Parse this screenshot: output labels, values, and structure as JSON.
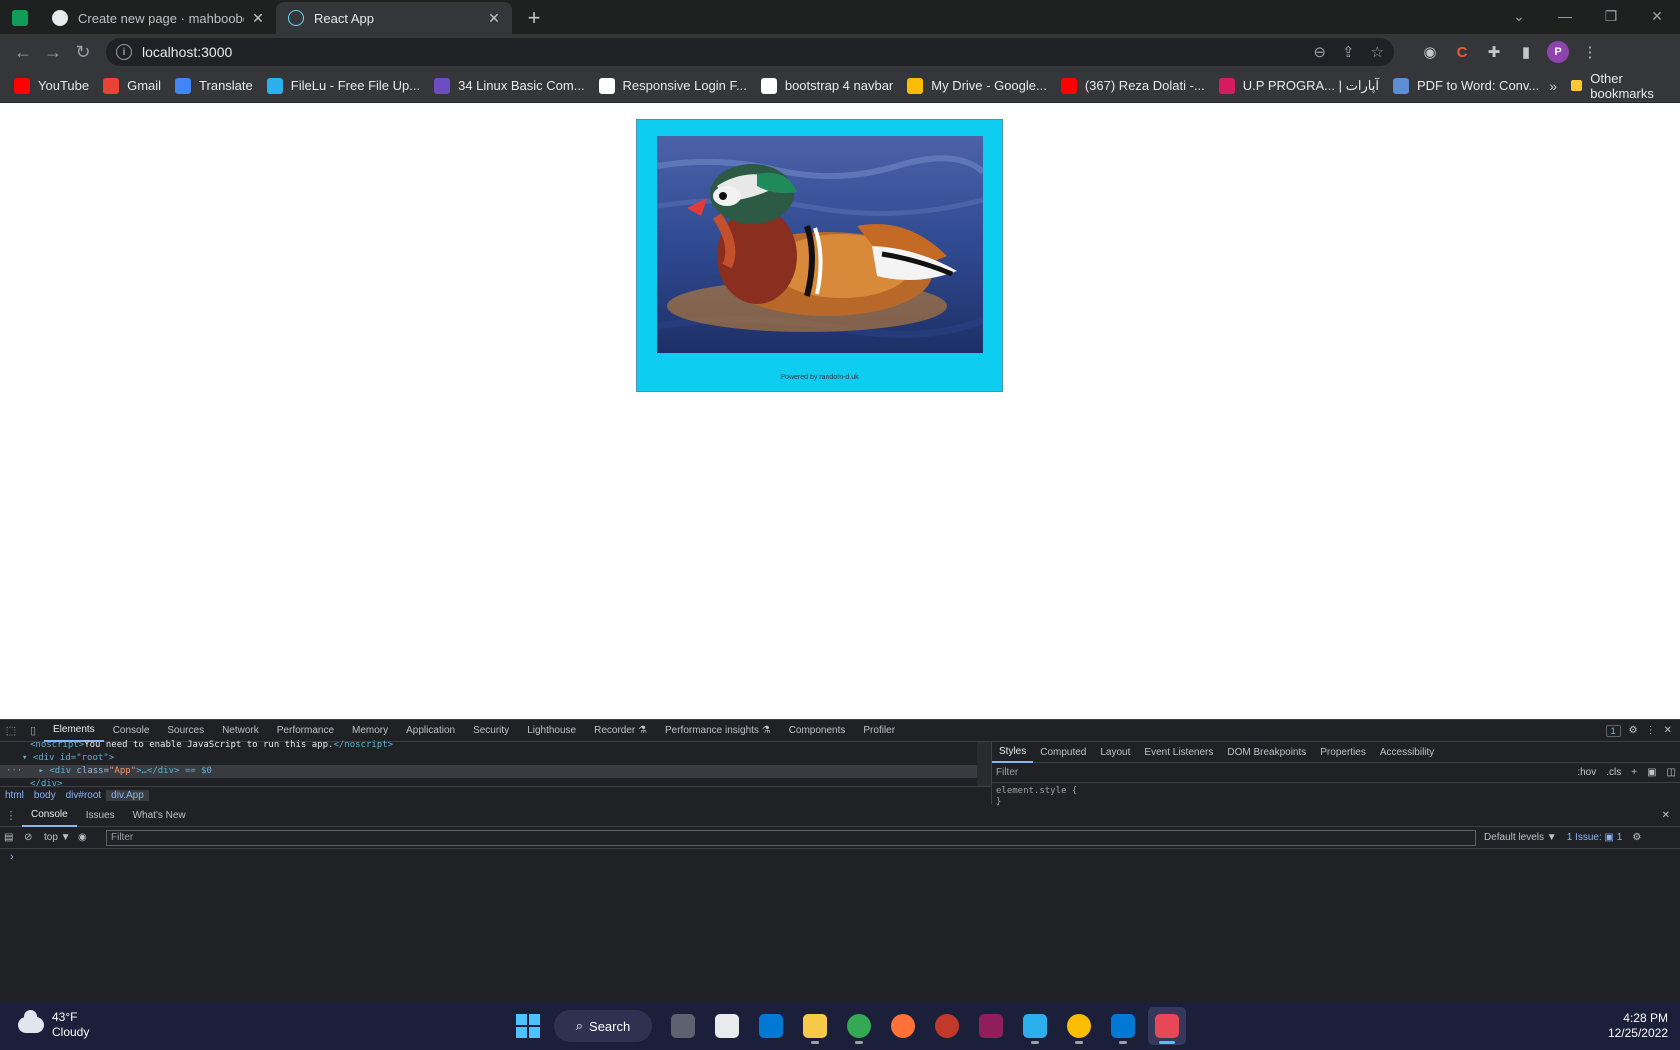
{
  "browser": {
    "tabs": [
      {
        "title": "Create new page · mahboobehjan",
        "close_icon": "close-icon"
      },
      {
        "title": "React App",
        "close_icon": "close-icon"
      }
    ],
    "address": "localhost:3000",
    "bookmarks": [
      {
        "label": "YouTube",
        "color": "#ff0000"
      },
      {
        "label": "Gmail",
        "color": "#ea4335"
      },
      {
        "label": "Translate",
        "color": "#4285f4"
      },
      {
        "label": "FileLu - Free File Up...",
        "color": "#2bb0ed"
      },
      {
        "label": "34 Linux Basic Com...",
        "color": "#6c4cc2"
      },
      {
        "label": "Responsive Login F...",
        "color": "#ffffff"
      },
      {
        "label": "bootstrap 4 navbar",
        "color": "#ffffff"
      },
      {
        "label": "My Drive - Google...",
        "color": "#fbbc04"
      },
      {
        "label": "(367) Reza Dolati -...",
        "color": "#ff0000"
      },
      {
        "label": "U.P PROGRA... | آپارات",
        "color": "#d81b60"
      },
      {
        "label": "PDF to Word: Conv...",
        "color": "#5f8dd3"
      }
    ],
    "other_bookmarks": "Other bookmarks",
    "profile_initial": "P"
  },
  "page": {
    "footer_text": "Powered by random-d.uk"
  },
  "devtools": {
    "tabs": [
      "Elements",
      "Console",
      "Sources",
      "Network",
      "Performance",
      "Memory",
      "Application",
      "Security",
      "Lighthouse",
      "Recorder ⚗",
      "Performance insights ⚗",
      "Components",
      "Profiler"
    ],
    "issues_count": "1",
    "dom": {
      "noscript_text": "You need to enable JavaScript to run this app.",
      "root_line": "<div id=\"root\">",
      "app_tag": "div",
      "app_attr": "class",
      "app_val": "\"App\"",
      "app_suffix": ">…</div> == $0",
      "close_line": "</div>"
    },
    "breadcrumb": [
      "html",
      "body",
      "div#root",
      "div.App"
    ],
    "styles_tabs": [
      "Styles",
      "Computed",
      "Layout",
      "Event Listeners",
      "DOM Breakpoints",
      "Properties",
      "Accessibility"
    ],
    "styles_filter": "Filter",
    "styles_toggles": [
      ":hov",
      ".cls",
      "+"
    ],
    "element_style": "element.style {",
    "element_style_close": "}",
    "drawer_tabs": [
      "Console",
      "Issues",
      "What's New"
    ],
    "console_context": "top ▼",
    "console_filter": "Filter",
    "default_levels": "Default levels ▼",
    "issue_summary": "1 Issue: ▣ 1"
  },
  "taskbar": {
    "temperature": "43°F",
    "condition": "Cloudy",
    "search": "Search",
    "time": "4:28 PM",
    "date": "12/25/2022"
  }
}
